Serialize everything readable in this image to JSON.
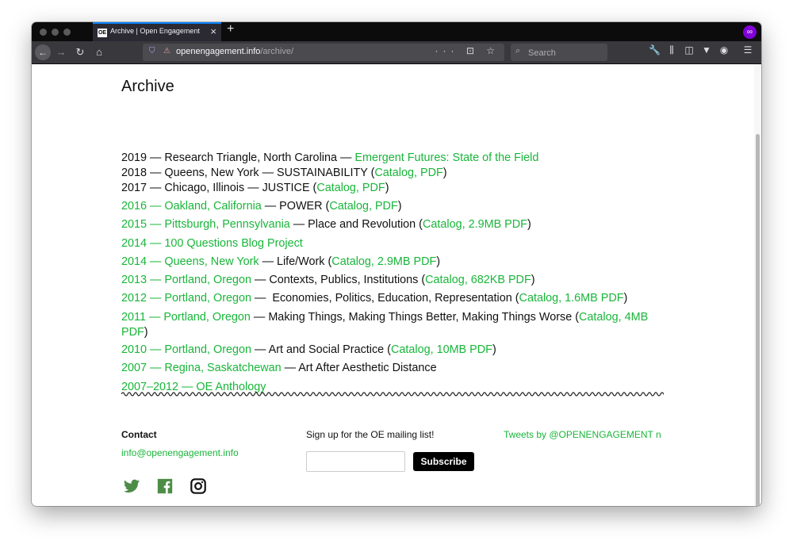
{
  "browser": {
    "tab_favicon": "OE",
    "tab_title": "Archive | Open Engagement",
    "tab_close": "×",
    "new_tab": "+",
    "url_host": "openengagement.info",
    "url_path": "/archive/",
    "page_actions": "··· ⊡ ☆",
    "search_placeholder": "Search",
    "icons": [
      "back-arrow",
      "forward-arrow",
      "reload",
      "home",
      "shield",
      "lock",
      "ellipsis",
      "pocket",
      "star",
      "search",
      "wrench",
      "library",
      "sidebar",
      "vpn",
      "account",
      "menu",
      "private-mask"
    ]
  },
  "page": {
    "title": "Archive",
    "entries": [
      {
        "year": "2019",
        "sep1": " — ",
        "place": "Research Triangle, North Carolina",
        "sep2": " — ",
        "link": "Emergent Futures: State of the Field"
      },
      {
        "prefix": "2018 — Queens, New York — SUSTAINABILITY (",
        "link": "Catalog, PDF",
        "suffix": ")"
      },
      {
        "prefix": "2017 — Chicago, Illinois — JUSTICE (",
        "link": "Catalog, PDF",
        "suffix": ")"
      },
      {
        "link1": "2016 — Oakland, California",
        "mid": " — POWER (",
        "link2": "Catalog, PDF",
        "suffix": ")"
      },
      {
        "link1": "2015 — Pittsburgh, Pennsylvania",
        "mid": " — Place and Revolution (",
        "link2": "Catalog, 2.9MB PDF",
        "suffix": ")"
      },
      {
        "link1": "2014 — 100 Questions Blog Project"
      },
      {
        "link1": "2014 — Queens, New York",
        "mid": " — Life/Work (",
        "link2": "Catalog, 2.9MB PDF",
        "suffix": ")"
      },
      {
        "link1": "2013 — Portland, Oregon",
        "mid": " — Contexts, Publics, Institutions (",
        "link2": "Catalog, 682KB PDF",
        "suffix": ")"
      },
      {
        "link1": "2012 — Portland, Oregon",
        "mid": " —  Economies, Politics, Education, Representation (",
        "link2": "Catalog, 1.6MB PDF",
        "suffix": ")"
      },
      {
        "link1": "2011 — Portland, Oregon",
        "mid": " — Making Things, Making Things Better, Making Things Worse (",
        "link2": "Catalog, 4MB PDF",
        "suffix": ")"
      },
      {
        "link1": "2010 — Portland, Oregon",
        "mid": " — Art and Social Practice (",
        "link2": "Catalog, 10MB PDF",
        "suffix": ")"
      },
      {
        "link1": "2007 — Regina, Saskatchewan",
        "mid": " — Art After Aesthetic Distance"
      },
      {
        "link1": "2007–2012 — OE Anthology"
      }
    ]
  },
  "footer": {
    "contact_heading": "Contact",
    "contact_email": "info@openengagement.info",
    "signup_text": "Sign up for the OE mailing list!",
    "subscribe_label": "Subscribe",
    "email_value": "",
    "tweets_text": "Tweets by @OPENENGAGEMENT n",
    "social_icons": [
      "twitter-icon",
      "facebook-icon",
      "instagram-icon"
    ]
  },
  "colors": {
    "link": "#19b63a",
    "social": "#4e8d47",
    "toolbar": "#38383d",
    "tabbar": "#0c0c0d",
    "private": "#8000d7"
  }
}
